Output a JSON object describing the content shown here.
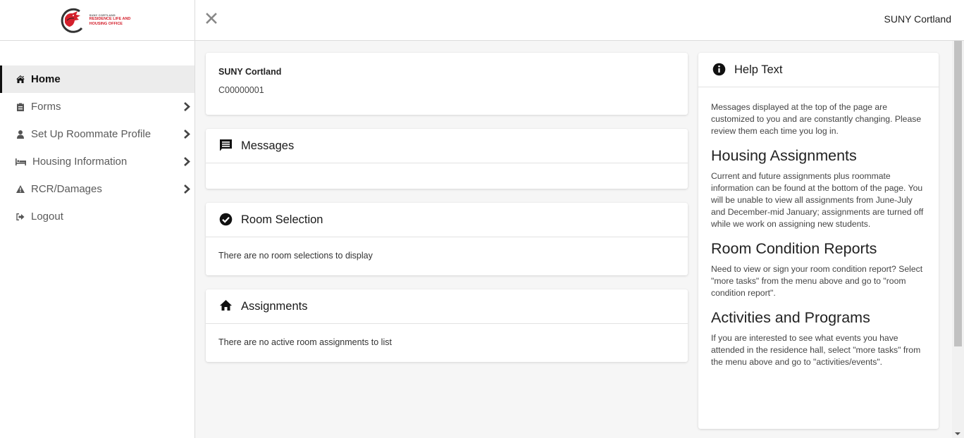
{
  "logo": {
    "line1": "SUNY CORTLAND",
    "line2": "RESIDENCE LIFE AND",
    "line3": "HOUSING OFFICE"
  },
  "topbar": {
    "close_icon": "close-icon",
    "institution": "SUNY Cortland"
  },
  "sidebar": {
    "items": [
      {
        "label": "Home",
        "icon": "home-icon",
        "active": true,
        "has_submenu": false
      },
      {
        "label": "Forms",
        "icon": "clipboard-icon",
        "active": false,
        "has_submenu": true
      },
      {
        "label": "Set Up Roommate Profile",
        "icon": "user-icon",
        "active": false,
        "has_submenu": true
      },
      {
        "label": "Housing Information",
        "icon": "bed-icon",
        "active": false,
        "has_submenu": true
      },
      {
        "label": "RCR/Damages",
        "icon": "warning-icon",
        "active": false,
        "has_submenu": true
      },
      {
        "label": "Logout",
        "icon": "sign-out-icon",
        "active": false,
        "has_submenu": false
      }
    ]
  },
  "profile": {
    "name": "SUNY Cortland",
    "id": "C00000001"
  },
  "messages": {
    "title": "Messages",
    "icon": "message-icon",
    "body": ""
  },
  "room_selection": {
    "title": "Room Selection",
    "icon": "check-circle-icon",
    "body": "There are no room selections to display"
  },
  "assignments": {
    "title": "Assignments",
    "icon": "home-icon",
    "body": "There are no active room assignments to list"
  },
  "help": {
    "title": "Help Text",
    "icon": "info-icon",
    "intro": "Messages displayed at the top of the page are customized to you and are constantly changing. Please review them each time you log in.",
    "sections": [
      {
        "heading": "Housing Assignments",
        "text": "Current and future assignments plus roommate information can be found at the bottom of the page. You will be unable to view all assignments from June-July and December-mid January; assignments are turned off while we work on assigning new students."
      },
      {
        "heading": "Room Condition Reports",
        "text": "Need to view or sign your room condition report? Select \"more tasks\" from the menu above and go to \"room condition report\"."
      },
      {
        "heading": "Activities and Programs",
        "text": "If you are interested to see what events you have attended in the residence hall, select \"more tasks\" from the menu above and go to \"activities/events\"."
      }
    ]
  },
  "colors": {
    "brand_red": "#d4202c",
    "active_nav_bg": "#ececec"
  }
}
